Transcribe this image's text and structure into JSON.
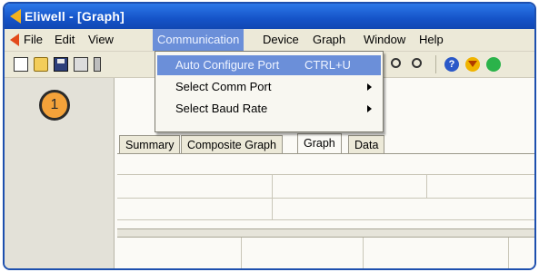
{
  "window": {
    "title": "Eliwell - [Graph]"
  },
  "menubar": {
    "items": [
      "File",
      "Edit",
      "View",
      "Communication",
      "Device",
      "Graph",
      "Window",
      "Help"
    ],
    "active": "Communication"
  },
  "dropdown": {
    "items": [
      {
        "label": "Auto Configure Port",
        "shortcut": "CTRL+U"
      },
      {
        "label": "Select Comm Port"
      },
      {
        "label": "Select Baud Rate"
      }
    ]
  },
  "tabs": [
    "Summary",
    "Composite Graph",
    "Graph",
    "Data"
  ],
  "active_tab": "Graph",
  "callout": {
    "number": "1"
  },
  "colors": {
    "titlebar": "#1553c8",
    "highlight": "#6b8fd9",
    "callout": "#f4a23a"
  }
}
